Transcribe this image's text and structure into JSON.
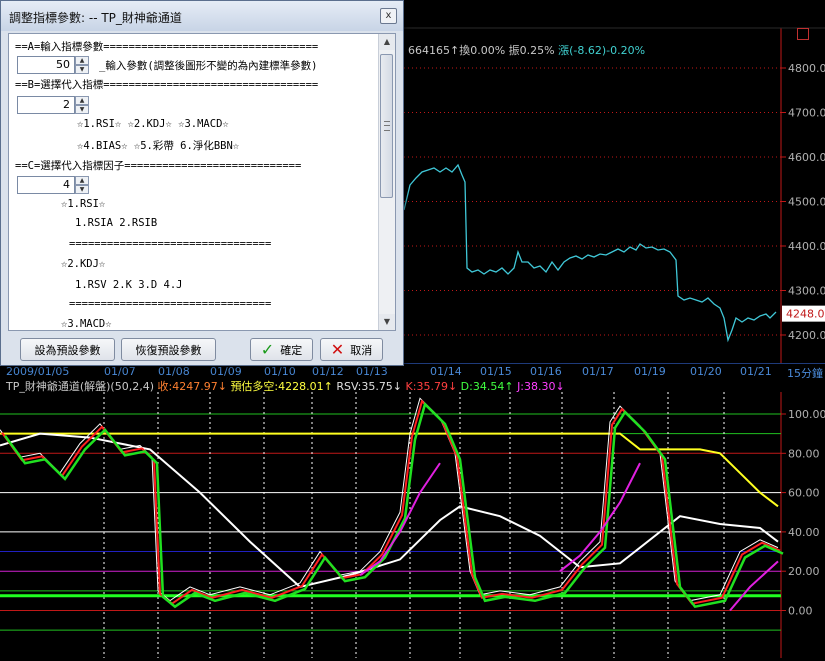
{
  "dialog": {
    "title": "調整指標參數: -- TP_財神爺通道",
    "close_label": "x",
    "lines": {
      "sec_a": "==A=輸入指標參數==================================",
      "param_a_desc": "_輸入參數(調整後圖形不變的為內建標準參數)",
      "sec_b": "==B=選擇代入指標==================================",
      "b_opts_1": "☆1.RSI☆   ☆2.KDJ☆   ☆3.MACD☆",
      "b_opts_2": "☆4.BIAS☆  ☆5.彩帶    6.淨化BBN☆",
      "sec_c": "==C=選擇代入指標因子============================",
      "c_rsi": "☆1.RSI☆",
      "c_rsi_items": "1.RSIA 2.RSIB",
      "c_sep1": "================================",
      "c_kdj": "☆2.KDJ☆",
      "c_kdj_items": "1.RSV  2.K    3.D     4.J",
      "c_sep2": "================================",
      "c_macd": "☆3.MACD☆"
    },
    "spin_a_value": "50",
    "spin_b_value": "2",
    "spin_c_value": "4",
    "buttons": {
      "set_default": "設為預設參數",
      "restore_default": "恢復預設參數",
      "ok": "確定",
      "cancel": "取消"
    }
  },
  "price_info": {
    "prefix": "664165↑換0.00% 振0.25% ",
    "change": "漲(-8.62)-0.20%"
  },
  "price_axis": {
    "ticks": [
      "4800.0",
      "4700.0",
      "4600.0",
      "4500.0",
      "4400.0",
      "4300.0",
      "4200.0"
    ],
    "current_price": "4248.0"
  },
  "date_bar": {
    "labels": [
      "2009/01/05",
      "01/07",
      "01/08",
      "01/09",
      "01/10",
      "01/12",
      "01/13",
      "01/14",
      "01/15",
      "01/16",
      "01/17",
      "01/19",
      "01/20",
      "01/21"
    ],
    "period": "15分鐘"
  },
  "indicator": {
    "title": "TP_財神爺通道(解盤)(50,2,4)",
    "close": "收:4247.97↓",
    "forecast": "預估多空:4228.01↑",
    "rsv": "RSV:35.75↓",
    "k": "K:35.79↓",
    "d": "D:34.54↑",
    "j": "J:38.30↓",
    "axis_ticks": [
      "100.00",
      "80.00",
      "60.00",
      "40.00",
      "20.00",
      "0.00"
    ]
  },
  "colors": {
    "price_line": "#40c8d8",
    "axis_red": "#c01818",
    "rsv": "#ffffff",
    "k": "#ff2020",
    "d": "#20e020",
    "j": "#e020e0",
    "yellow": "#ffff20",
    "green_band": "#20ff20"
  },
  "chart_data": {
    "type": "line",
    "series": [
      {
        "name": "收",
        "values": [
          4560,
          4575,
          4560,
          4340,
          4350,
          4380,
          4370,
          4390,
          4395,
          4385,
          4390,
          4300,
          4240,
          4248
        ]
      },
      {
        "name": "K",
        "values": [
          85,
          80,
          5,
          8,
          10,
          30,
          105,
          8,
          10,
          35,
          100,
          5,
          10,
          35.79
        ]
      },
      {
        "name": "D",
        "values": [
          85,
          82,
          8,
          8,
          10,
          25,
          95,
          10,
          10,
          30,
          95,
          10,
          10,
          34.54
        ]
      },
      {
        "name": "J",
        "values": [
          null,
          null,
          null,
          null,
          null,
          null,
          70,
          null,
          null,
          20,
          70,
          null,
          null,
          38.3
        ]
      }
    ],
    "x": [
      "01/05",
      "01/07",
      "01/08",
      "01/09",
      "01/10",
      "01/12",
      "01/13",
      "01/14",
      "01/15",
      "01/16",
      "01/17",
      "01/19",
      "01/20",
      "01/21"
    ],
    "ylim": [
      -10,
      110
    ]
  }
}
